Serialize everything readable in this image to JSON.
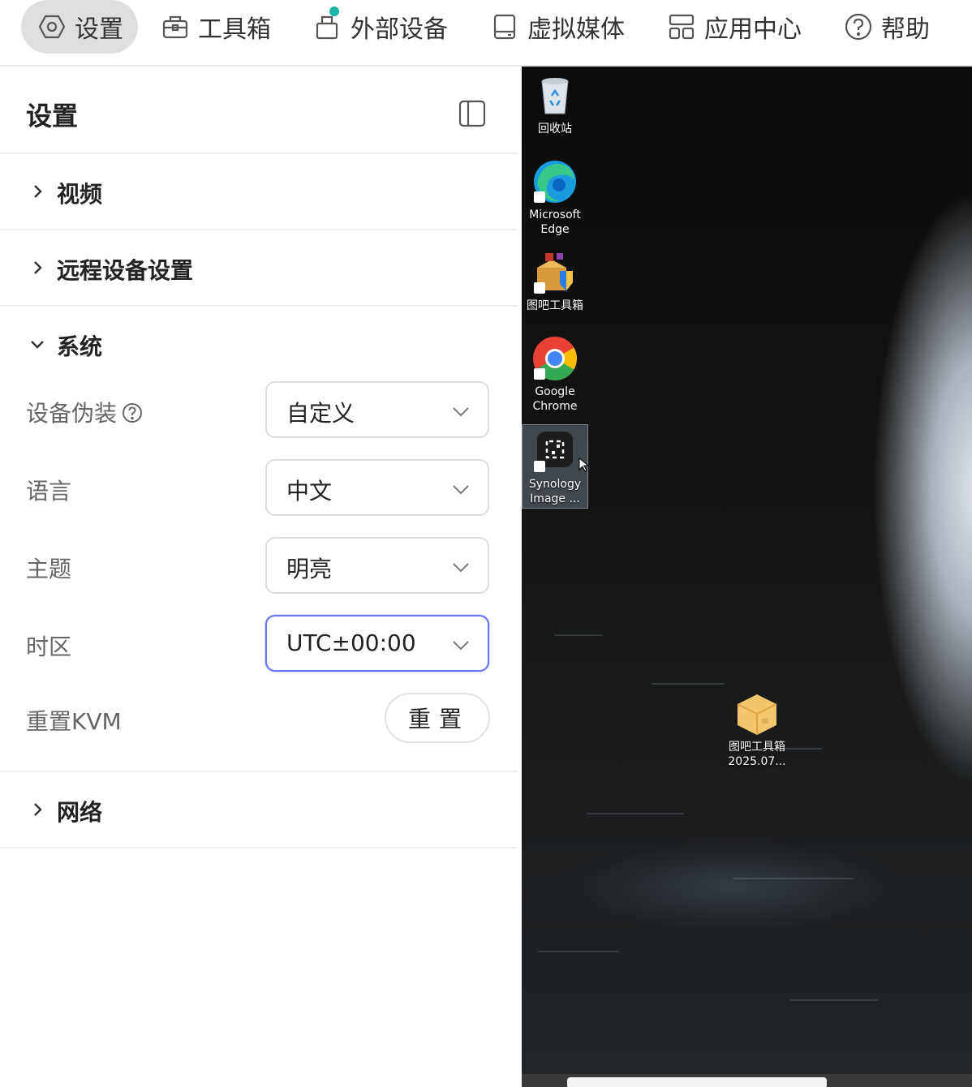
{
  "topnav": {
    "items": [
      {
        "label": "设置",
        "icon": "gear-icon"
      },
      {
        "label": "工具箱",
        "icon": "toolbox-icon"
      },
      {
        "label": "外部设备",
        "icon": "usb-device-icon"
      },
      {
        "label": "虚拟媒体",
        "icon": "disk-icon"
      },
      {
        "label": "应用中心",
        "icon": "apps-icon"
      },
      {
        "label": "帮助",
        "icon": "help-icon"
      }
    ]
  },
  "panel": {
    "title": "设置",
    "sections": {
      "video": "视频",
      "remote": "远程设备设置",
      "system": "系统",
      "network": "网络"
    },
    "system": {
      "disguise_label": "设备伪装",
      "disguise_value": "自定义",
      "language_label": "语言",
      "language_value": "中文",
      "theme_label": "主题",
      "theme_value": "明亮",
      "timezone_label": "时区",
      "timezone_value": "UTC±00:00",
      "reset_label": "重置KVM",
      "reset_button": "重置"
    }
  },
  "desktop": {
    "icons": [
      {
        "label": "回收站",
        "icon": "recycle-bin-icon"
      },
      {
        "label": "Microsoft Edge",
        "icon": "edge-icon"
      },
      {
        "label": "图吧工具箱",
        "icon": "toolbox-app-icon"
      },
      {
        "label": "Google Chrome",
        "icon": "chrome-icon"
      },
      {
        "label": "Synology Image ...",
        "icon": "synology-icon"
      },
      {
        "label": "图吧工具箱 2025.07...",
        "icon": "package-icon"
      }
    ]
  }
}
